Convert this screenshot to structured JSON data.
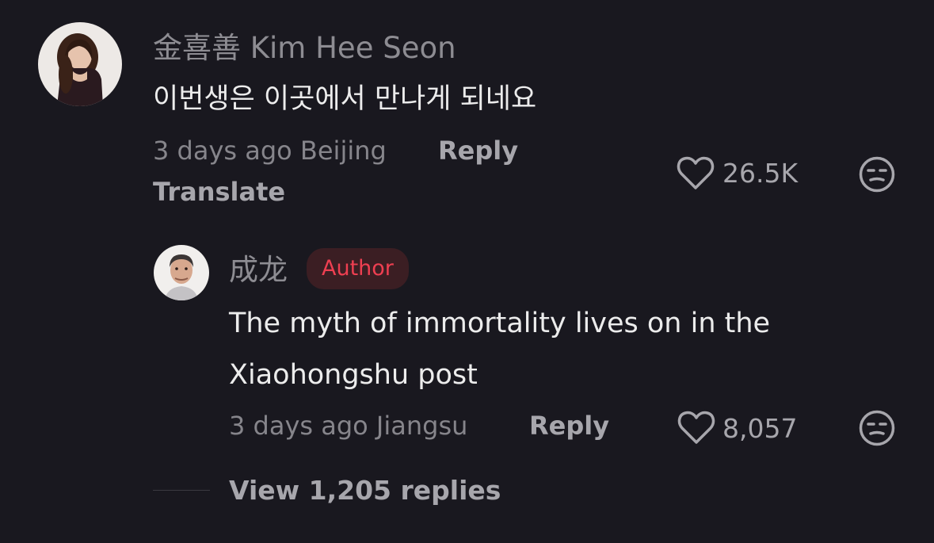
{
  "comments": [
    {
      "author": "金喜善 Kim Hee Seon",
      "text": "이번생은 이곳에서 만나게 되네요",
      "time_location": "3 days ago Beijing",
      "reply_label": "Reply",
      "translate_label": "Translate",
      "likes": "26.5K",
      "avatar_icon": "woman-portrait"
    }
  ],
  "reply": {
    "author": "成龙",
    "badge": "Author",
    "text_line1": "The myth of immortality lives on in the",
    "text_line2": "Xiaohongshu post",
    "time_location": "3 days ago Jiangsu",
    "reply_label": "Reply",
    "likes": "8,057",
    "avatar_icon": "man-portrait"
  },
  "view_replies_label": "View 1,205 replies",
  "icons": {
    "like": "heart-outline-icon",
    "reaction": "unamused-face-icon"
  },
  "colors": {
    "background": "#19181f",
    "badge_text": "#ee3f51",
    "badge_bg": "#3b1e23"
  }
}
